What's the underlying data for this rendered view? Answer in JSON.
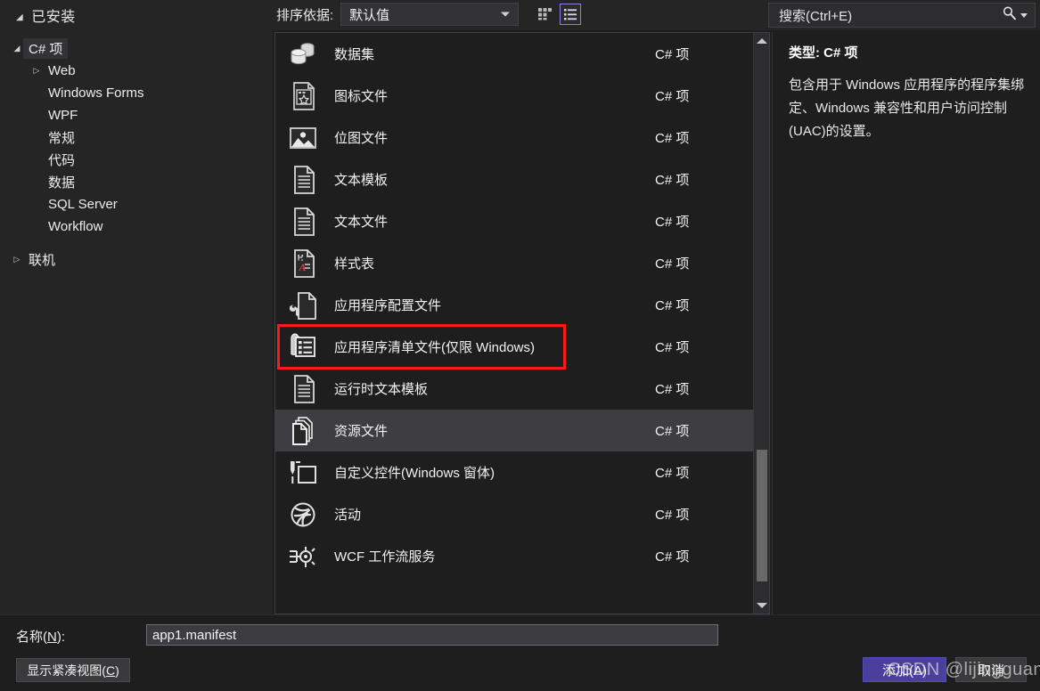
{
  "header": {
    "installed_title": "已安装",
    "sort_label": "排序依据:",
    "sort_value": "默认值",
    "grid_view_icon": "grid-view-icon",
    "list_view_icon": "list-view-icon",
    "search_placeholder": "搜索(Ctrl+E)",
    "search_value": "",
    "search_icon": "search-icon"
  },
  "tree": {
    "nodes": [
      {
        "label": "C# 项",
        "indent": 0,
        "arrow": "◢",
        "selected": true
      },
      {
        "label": "Web",
        "indent": 1,
        "arrow": "▷",
        "selected": false
      },
      {
        "label": "Windows Forms",
        "indent": 1,
        "arrow": "",
        "selected": false
      },
      {
        "label": "WPF",
        "indent": 1,
        "arrow": "",
        "selected": false
      },
      {
        "label": "常规",
        "indent": 1,
        "arrow": "",
        "selected": false
      },
      {
        "label": "代码",
        "indent": 1,
        "arrow": "",
        "selected": false
      },
      {
        "label": "数据",
        "indent": 1,
        "arrow": "",
        "selected": false
      },
      {
        "label": "SQL Server",
        "indent": 1,
        "arrow": "",
        "selected": false
      },
      {
        "label": "Workflow",
        "indent": 1,
        "arrow": "",
        "selected": false
      }
    ],
    "online_label": "联机",
    "online_arrow": "▷"
  },
  "list": {
    "items": [
      {
        "label": "数据集",
        "type": "C# 项",
        "icon": "dataset-icon",
        "selected": false,
        "highlighted": false
      },
      {
        "label": "图标文件",
        "type": "C# 项",
        "icon": "icon-file-icon",
        "selected": false,
        "highlighted": false
      },
      {
        "label": "位图文件",
        "type": "C# 项",
        "icon": "bitmap-file-icon",
        "selected": false,
        "highlighted": false
      },
      {
        "label": "文本模板",
        "type": "C# 项",
        "icon": "text-template-icon",
        "selected": false,
        "highlighted": false
      },
      {
        "label": "文本文件",
        "type": "C# 项",
        "icon": "text-file-icon",
        "selected": false,
        "highlighted": false
      },
      {
        "label": "样式表",
        "type": "C# 项",
        "icon": "stylesheet-icon",
        "selected": false,
        "highlighted": false
      },
      {
        "label": "应用程序配置文件",
        "type": "C# 项",
        "icon": "app-config-file-icon",
        "selected": false,
        "highlighted": false
      },
      {
        "label": "应用程序清单文件(仅限 Windows)",
        "type": "C# 项",
        "icon": "app-manifest-file-icon",
        "selected": false,
        "highlighted": true
      },
      {
        "label": "运行时文本模板",
        "type": "C# 项",
        "icon": "runtime-text-template-icon",
        "selected": false,
        "highlighted": false
      },
      {
        "label": "资源文件",
        "type": "C# 项",
        "icon": "resource-file-icon",
        "selected": true,
        "highlighted": false
      },
      {
        "label": "自定义控件(Windows 窗体)",
        "type": "C# 项",
        "icon": "custom-control-icon",
        "selected": false,
        "highlighted": false
      },
      {
        "label": "活动",
        "type": "C# 项",
        "icon": "activity-icon",
        "selected": false,
        "highlighted": false
      },
      {
        "label": "WCF 工作流服务",
        "type": "C# 项",
        "icon": "wcf-workflow-service-icon",
        "selected": false,
        "highlighted": false
      }
    ],
    "highlight_color": "#ff1a1a",
    "selection_color": "#3e3e42"
  },
  "description": {
    "type_label": "类型:",
    "type_value": "C# 项",
    "type_line": "类型: C# 项",
    "body": "包含用于 Windows 应用程序的程序集绑定、Windows 兼容性和用户访问控制(UAC)的设置。"
  },
  "bottom": {
    "name_label_prefix": "名称(",
    "name_label_key": "N",
    "name_label_suffix": "):",
    "name_value": "app1.manifest",
    "compact_prefix": "显示紧凑视图(",
    "compact_key": "C",
    "compact_suffix": ")",
    "add_label": "添加(A)",
    "cancel_label": "取消"
  },
  "watermark": {
    "text": "CSDN @lijingguang"
  },
  "colors": {
    "accent": "#4b3f9e",
    "toggle_active_border": "#8a7fe0",
    "panel_bg": "#252526",
    "window_bg": "#1e1e1e",
    "row_selected": "#3e3e42",
    "highlight_red": "#ff1a1a"
  }
}
